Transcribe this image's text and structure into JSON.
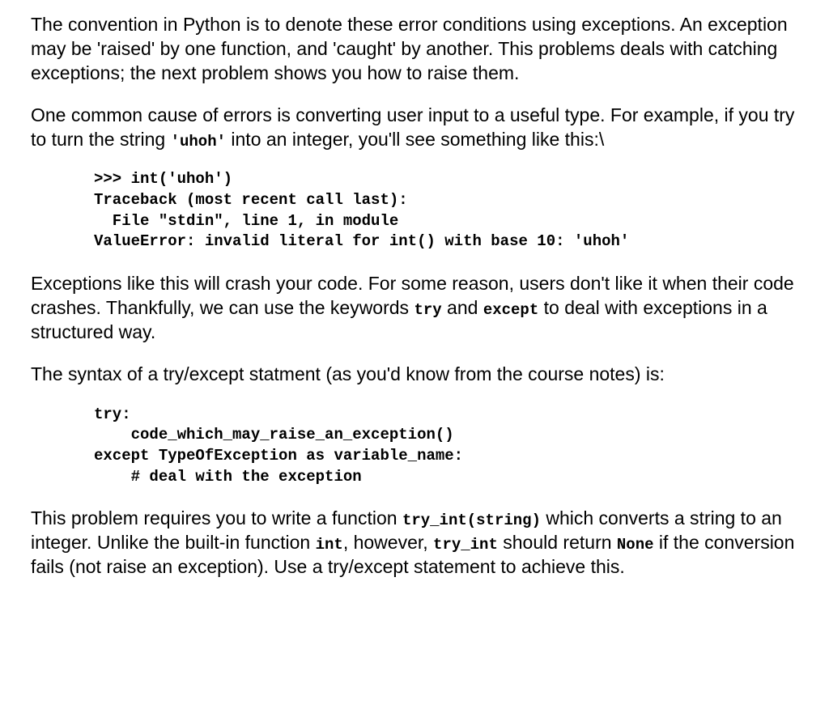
{
  "para1": "The convention in Python is to denote these error conditions using exceptions. An exception may be 'raised' by one function, and 'caught' by another. This problems deals with catching exceptions; the next problem shows you how to raise them.",
  "para2_a": "One common cause of errors is converting user input to a useful type. For example, if you try to turn the string ",
  "para2_code": "'uhoh'",
  "para2_b": " into an integer, you'll see something like this:\\",
  "codeblock1": ">>> int('uhoh')\nTraceback (most recent call last):\n  File \"stdin\", line 1, in module\nValueError: invalid literal for int() with base 10: 'uhoh'",
  "para3_a": "Exceptions like this will crash your code. For some reason, users don't like it when their code crashes. Thankfully, we can use the keywords ",
  "para3_code1": "try",
  "para3_b": " and ",
  "para3_code2": "except",
  "para3_c": " to deal with exceptions in a structured way.",
  "para4": "The syntax of a try/except statment (as you'd know from the course notes) is:",
  "codeblock2": "try:\n    code_which_may_raise_an_exception()\nexcept TypeOfException as variable_name:\n    # deal with the exception",
  "para5_a": "This problem requires you to write a function ",
  "para5_code1": "try_int(string)",
  "para5_b": " which converts a string to an integer. Unlike the built-in function ",
  "para5_code2": "int",
  "para5_c": ", however, ",
  "para5_code3": "try_int",
  "para5_d": " should return ",
  "para5_code4": "None",
  "para5_e": " if the conversion fails (not raise an exception). Use a try/except statement to achieve this."
}
